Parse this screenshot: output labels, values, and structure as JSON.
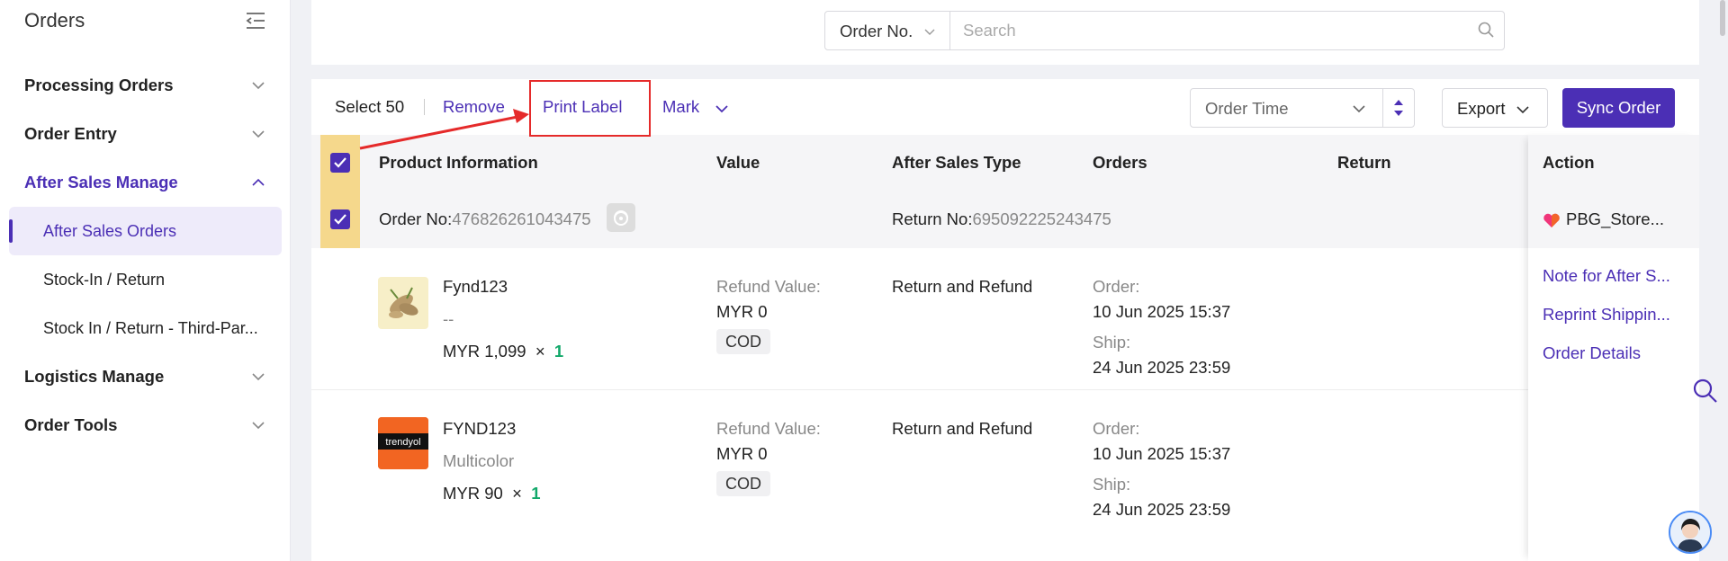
{
  "sidebar": {
    "title": "Orders",
    "items": [
      {
        "label": "Processing Orders"
      },
      {
        "label": "Order Entry"
      },
      {
        "label": "After Sales Manage"
      },
      {
        "label": "Logistics Manage"
      },
      {
        "label": "Order Tools"
      }
    ],
    "subitems": [
      {
        "label": "After Sales Orders"
      },
      {
        "label": "Stock-In / Return"
      },
      {
        "label": "Stock In / Return - Third-Par..."
      }
    ]
  },
  "search": {
    "type_label": "Order No.",
    "placeholder": "Search"
  },
  "toolbar": {
    "select_label": "Select 50",
    "remove_label": "Remove",
    "print_label": "Print Label",
    "mark_label": "Mark",
    "order_time_label": "Order Time",
    "export_label": "Export",
    "sync_label": "Sync Order"
  },
  "table": {
    "headers": [
      "Product Information",
      "Value",
      "After Sales Type",
      "Orders",
      "Return",
      "Action"
    ],
    "group": {
      "order_prefix": "Order No:",
      "order_no": "476826261043475",
      "return_prefix": "Return No:",
      "return_no": "695092225243475",
      "store": "PBG_Store..."
    },
    "rows": [
      {
        "name": "Fynd123",
        "variant": "--",
        "price": "MYR 1,099",
        "times": "×",
        "qty": "1",
        "refund_label": "Refund Value:",
        "refund_value": "MYR 0",
        "payment": "COD",
        "after_sales_type": "Return and Refund",
        "order_label": "Order:",
        "order_time": "10 Jun 2025 15:37",
        "ship_label": "Ship:",
        "ship_time": "24 Jun 2025 23:59"
      },
      {
        "name": "FYND123",
        "variant": "Multicolor",
        "price": "MYR 90",
        "times": "×",
        "qty": "1",
        "logo_text": "trendyol",
        "refund_label": "Refund Value:",
        "refund_value": "MYR 0",
        "payment": "COD",
        "after_sales_type": "Return and Refund",
        "order_label": "Order:",
        "order_time": "10 Jun 2025 15:37",
        "ship_label": "Ship:",
        "ship_time": "24 Jun 2025 23:59"
      }
    ],
    "actions": [
      "Note for After S...",
      "Reprint Shippin...",
      "Order Details"
    ]
  },
  "colors": {
    "accent": "#4b2fb5",
    "highlight": "#e52a2a",
    "qty": "#12a86a"
  }
}
